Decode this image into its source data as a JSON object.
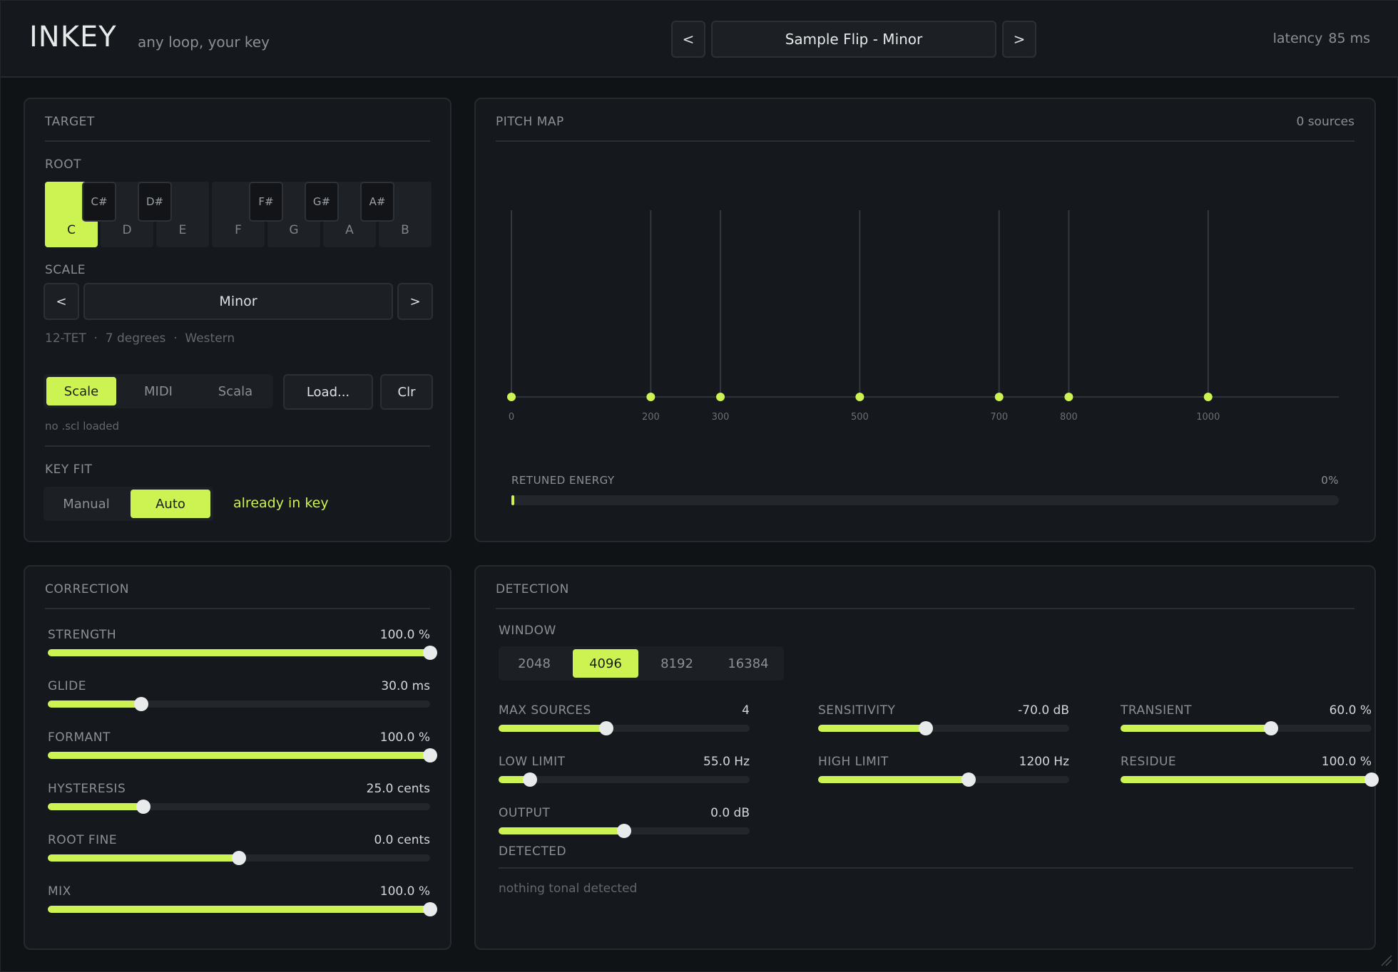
{
  "header": {
    "title": "INKEY",
    "tagline": "any loop, your key",
    "prev": "<",
    "next": ">",
    "preset": "Sample Flip - Minor",
    "latency_label": "latency",
    "latency_value": "85 ms"
  },
  "target": {
    "title": "TARGET",
    "root_label": "ROOT",
    "white_keys": [
      "C",
      "D",
      "E",
      "F",
      "G",
      "A",
      "B"
    ],
    "black_keys": [
      "C#",
      "D#",
      "F#",
      "G#",
      "A#"
    ],
    "selected_root": "C",
    "scale_label": "SCALE",
    "scale_prev": "<",
    "scale_next": ">",
    "scale_name": "Minor",
    "scale_info": "12-TET  ·  7 degrees  ·  Western",
    "source_tabs": [
      "Scale",
      "MIDI",
      "Scala"
    ],
    "source_active": "Scale",
    "load": "Load...",
    "clear": "Clr",
    "scl_status": "no .scl loaded",
    "keyfit_label": "KEY FIT",
    "keyfit_tabs": [
      "Manual",
      "Auto"
    ],
    "keyfit_active": "Auto",
    "keyfit_status": "already in key"
  },
  "pitch_map": {
    "title": "PITCH MAP",
    "sources": "0 sources",
    "degrees": [
      0,
      200,
      300,
      500,
      700,
      800,
      1000
    ],
    "tick_labels": [
      "0",
      "200",
      "300",
      "500",
      "700",
      "800",
      "1000"
    ],
    "energy_label": "RETUNED ENERGY",
    "energy_value": "0%",
    "energy_fraction": 0
  },
  "correction": {
    "title": "CORRECTION",
    "sliders": [
      {
        "label": "STRENGTH",
        "value": "100.0 %",
        "fraction": 1.0
      },
      {
        "label": "GLIDE",
        "value": "30.0 ms",
        "fraction": 0.245
      },
      {
        "label": "FORMANT",
        "value": "100.0 %",
        "fraction": 1.0
      },
      {
        "label": "HYSTERESIS",
        "value": "25.0 cents",
        "fraction": 0.25
      },
      {
        "label": "ROOT FINE",
        "value": "0.0 cents",
        "fraction": 0.5
      },
      {
        "label": "MIX",
        "value": "100.0 %",
        "fraction": 1.0
      }
    ]
  },
  "detection": {
    "title": "DETECTION",
    "window_label": "WINDOW",
    "windows": [
      "2048",
      "4096",
      "8192",
      "16384"
    ],
    "window_active": "4096",
    "sliders": [
      {
        "label": "MAX SOURCES",
        "value": "4",
        "fraction": 0.43
      },
      {
        "label": "SENSITIVITY",
        "value": "-70.0 dB",
        "fraction": 0.43
      },
      {
        "label": "TRANSIENT",
        "value": "60.0 %",
        "fraction": 0.6
      },
      {
        "label": "LOW LIMIT",
        "value": "55.0 Hz",
        "fraction": 0.125
      },
      {
        "label": "HIGH LIMIT",
        "value": "1200 Hz",
        "fraction": 0.6
      },
      {
        "label": "RESIDUE",
        "value": "100.0 %",
        "fraction": 1.0
      },
      {
        "label": "OUTPUT",
        "value": "0.0 dB",
        "fraction": 0.5
      }
    ],
    "detected_label": "DETECTED",
    "detected_status": "nothing tonal detected"
  },
  "colors": {
    "accent": "#cdf352",
    "background": "#101316",
    "panel": "#15181c"
  }
}
